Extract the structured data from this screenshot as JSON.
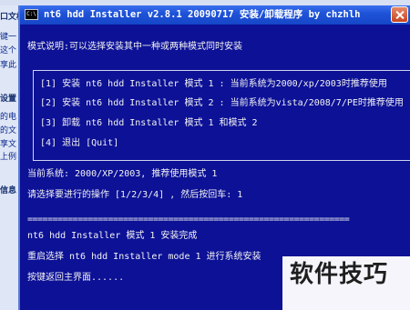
{
  "background_panel": {
    "items": [
      "口文档",
      "键一",
      "这个",
      "享此",
      "设置",
      "的电",
      "的文",
      "享文",
      "上例",
      "信息"
    ]
  },
  "window": {
    "title": "nt6 hdd Installer v2.8.1 20090717 安装/卸载程序 by chzhlh",
    "icon_label": "C:\\"
  },
  "console": {
    "mode_description": "模式说明:可以选择安装其中一种或两种模式同时安装",
    "menu": [
      "[1] 安装 nt6 hdd Installer 模式 1 : 当前系统为2000/xp/2003时推荐使用",
      "[2] 安装 nt6 hdd Installer 模式 2 : 当前系统为vista/2008/7/PE时推荐使用",
      "[3] 卸载 nt6 hdd Installer 模式 1 和模式 2",
      "[4] 退出 [Quit]"
    ],
    "current_system": "当前系统: 2000/XP/2003, 推荐使用模式 1",
    "prompt": "请选择要进行的操作 [1/2/3/4] , 然后按回车: 1",
    "separator": "================================================================",
    "done": "nt6 hdd Installer 模式 1 安装完成",
    "restart": "重启选择 nt6 hdd Installer mode 1 进行系统安装",
    "return_main": "按键返回主界面......"
  },
  "watermark": "软件技巧",
  "colors": {
    "console_bg": "#0c1196",
    "console_text": "#f2f2f2",
    "titlebar": "#1f53d8"
  }
}
